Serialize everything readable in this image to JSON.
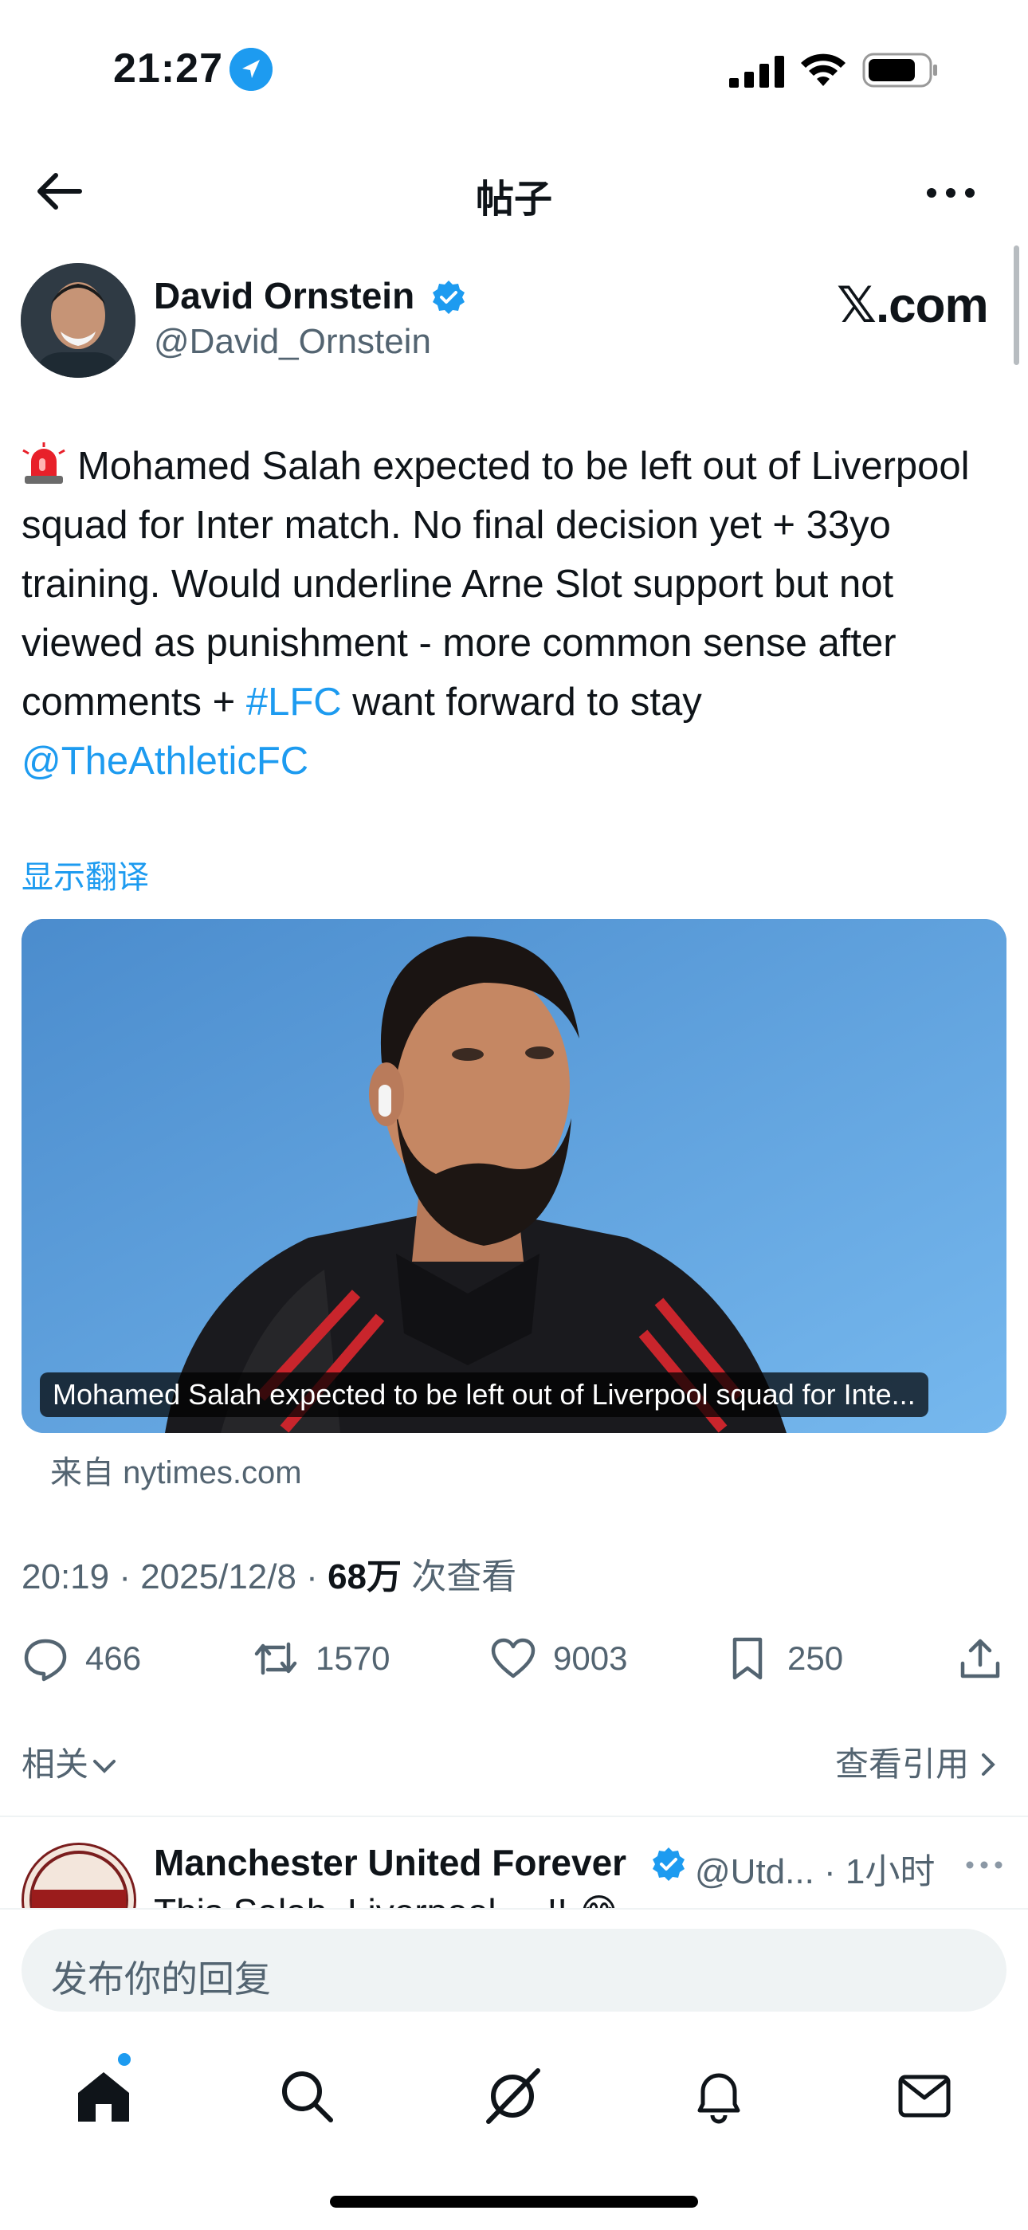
{
  "status_bar": {
    "time": "21:27"
  },
  "header": {
    "title": "帖子"
  },
  "author": {
    "name": "David Ornstein",
    "handle": "@David_Ornstein",
    "brand": "𝕏.com"
  },
  "tweet": {
    "text_before_hashtag": "Mohamed Salah expected to be left out of Liverpool squad for Inter match. No final decision yet + 33yo training. Would underline Arne Slot support but not viewed as punishment - more common sense after comments + ",
    "hashtag": "#LFC",
    "text_after_hashtag": " want forward to stay ",
    "mention": "@TheAthleticFC",
    "translate_label": "显示翻译"
  },
  "card": {
    "caption": "Mohamed Salah expected to be left out of Liverpool squad for Inte...",
    "source": "来自 nytimes.com"
  },
  "meta": {
    "time_date": "20:19 · 2025/12/8 · ",
    "views_count": "68万",
    "views_label": " 次查看"
  },
  "actions": {
    "replies": "466",
    "reposts": "1570",
    "likes": "9003",
    "bookmarks": "250"
  },
  "links": {
    "related": "相关",
    "view_quotes": "查看引用"
  },
  "reply_preview": {
    "name": "Manchester United Forever",
    "meta": "@Utd... · 1小时",
    "text": "This Salah, Liverpool ... !! 😂"
  },
  "composer": {
    "placeholder": "发布你的回复"
  },
  "colors": {
    "accent": "#1d9bf0",
    "text": "#0f1419",
    "secondary": "#536471"
  }
}
